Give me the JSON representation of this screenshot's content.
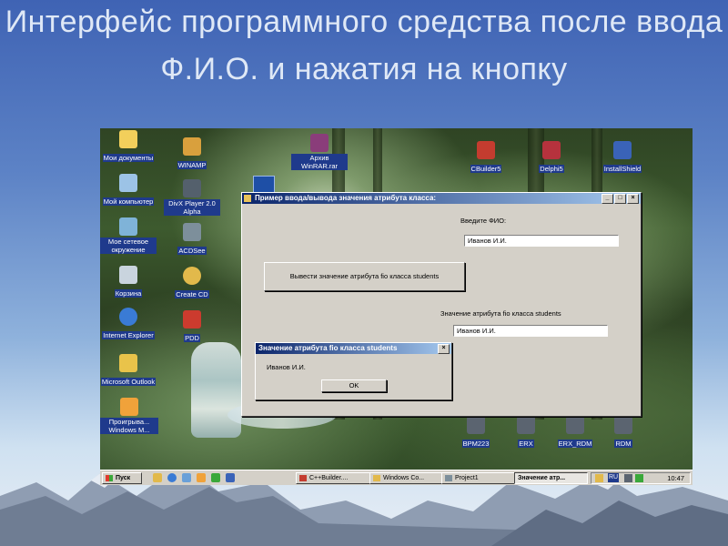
{
  "slide": {
    "title": "Интерфейс программного средства после ввода Ф.И.О. и нажатия на кнопку"
  },
  "desktop_icons": [
    {
      "id": "my-documents",
      "label": "Мои документы",
      "color": "#f2cf5b"
    },
    {
      "id": "my-computer",
      "label": "Мой компьютер",
      "color": "#9cc3e6"
    },
    {
      "id": "my-network",
      "label": "Мое сетевое окружение",
      "color": "#7fb3d8"
    },
    {
      "id": "recycle-bin",
      "label": "Корзина",
      "color": "#c9d4de"
    },
    {
      "id": "internet-explorer",
      "label": "Internet Explorer",
      "color": "#3a7bd5"
    },
    {
      "id": "microsoft-outlook",
      "label": "Microsoft Outlook",
      "color": "#e9c34a"
    },
    {
      "id": "windows-media",
      "label": "Проигрыва... Windows M...",
      "color": "#f0a23a"
    },
    {
      "id": "winamp",
      "label": "WINAMP",
      "color": "#d9a03d"
    },
    {
      "id": "divx-player",
      "label": "DivX Player 2.0 Alpha",
      "color": "#54606c"
    },
    {
      "id": "acdsee",
      "label": "ACDSee",
      "color": "#7d8f9b"
    },
    {
      "id": "create-cd",
      "label": "Create CD",
      "color": "#e2b94b"
    },
    {
      "id": "pdd",
      "label": "PDD",
      "color": "#cc3b2e"
    },
    {
      "id": "winrar-archive",
      "label": "Архив WinRAR.rar",
      "color": "#8a3d7a"
    },
    {
      "id": "cbuilder5",
      "label": "CBuilder5",
      "color": "#c43c2f"
    },
    {
      "id": "delphi5",
      "label": "Delphi5",
      "color": "#b6323d"
    },
    {
      "id": "installshield",
      "label": "InstallShield",
      "color": "#3a63b8"
    },
    {
      "id": "bpm223",
      "label": "BPM223",
      "color": "#5b6470"
    },
    {
      "id": "erx",
      "label": "ERX",
      "color": "#5b6470"
    },
    {
      "id": "erx-rdm",
      "label": "ERX_RDM",
      "color": "#5b6470"
    },
    {
      "id": "rdm",
      "label": "RDM",
      "color": "#5b6470"
    }
  ],
  "main_window": {
    "title": "Пример ввода/вывода значения атрибута класса:",
    "fio_prompt": "Введите ФИО:",
    "fio_value": "Иванов И.И.",
    "show_button_label": "Вывести значение атрибута fio класса students",
    "attr_label": "Значение атрибута fio класса students",
    "attr_value": "Иванов И.И.",
    "minimize_glyph": "_",
    "maximize_glyph": "□",
    "close_glyph": "×"
  },
  "message_box": {
    "title": "Значение атрибута fio класса students",
    "message": "Иванов И.И.",
    "ok_label": "OK",
    "close_glyph": "×"
  },
  "taskbar": {
    "start_label": "Пуск",
    "tasks": [
      {
        "label": "C++Builder...."
      },
      {
        "label": "Windows Co..."
      },
      {
        "label": "Project1"
      },
      {
        "label": "Значение атр..."
      }
    ],
    "language": "RU",
    "clock": "10:47"
  }
}
